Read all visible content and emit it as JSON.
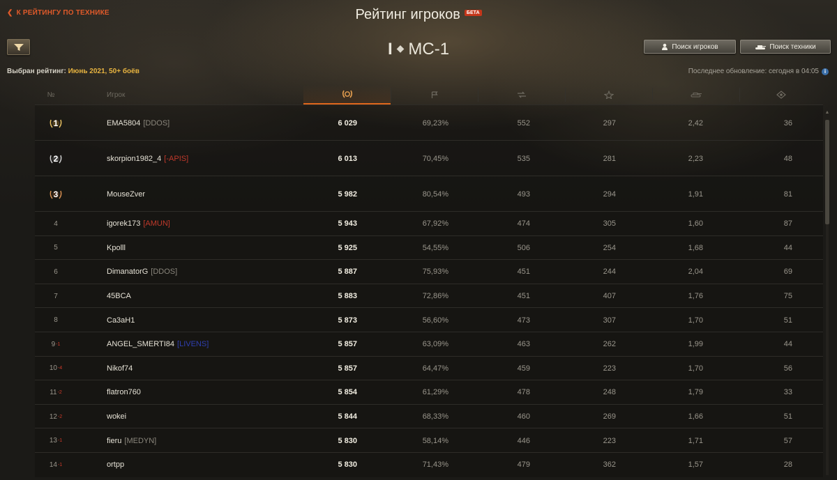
{
  "nav": {
    "back_label": "К РЕЙТИНГУ ПО ТЕХНИКЕ",
    "back_icon": "chevron-left-icon"
  },
  "header": {
    "title": "Рейтинг игроков",
    "beta_badge": "БЕТА",
    "vehicle_tier": "I",
    "vehicle_name": "МС-1"
  },
  "filter": {
    "icon": "filter-icon"
  },
  "buttons": {
    "find_players": "Поиск игроков",
    "find_vehicles": "Поиск техники"
  },
  "rating": {
    "label": "Выбран рейтинг:",
    "value": "Июнь 2021, 50+ боёв"
  },
  "update": {
    "label": "Последнее обновление: сегодня в 04:05"
  },
  "columns": {
    "rank": "№",
    "player": "Игрок",
    "score_icon": "laurel-icon",
    "winrate_icon": "flag-icon",
    "battles_icon": "battles-icon",
    "damage_icon": "damage-icon",
    "frags_icon": "frags-icon",
    "spot_icon": "spotting-icon"
  },
  "colors": {
    "accent": "#e0671c",
    "gold": "#e8b440",
    "clan_red": "#c0392b",
    "clan_blue": "#2f3fb0",
    "clan_gray": "#8a867c",
    "change_down": "#d03a2a"
  },
  "rows": [
    {
      "rank": "1",
      "change": "",
      "medal": "gold",
      "player": "EMA5804",
      "clan": "[DDOS]",
      "clan_color": "gray",
      "score": "6 029",
      "winrate": "69,23%",
      "battles": "552",
      "damage": "297",
      "frags": "2,42",
      "spot": "36"
    },
    {
      "rank": "2",
      "change": "",
      "medal": "silver",
      "player": "skorpion1982_4",
      "clan": "[-APIS]",
      "clan_color": "red",
      "score": "6 013",
      "winrate": "70,45%",
      "battles": "535",
      "damage": "281",
      "frags": "2,23",
      "spot": "48"
    },
    {
      "rank": "3",
      "change": "",
      "medal": "bronze",
      "player": "MouseZver",
      "clan": "",
      "clan_color": "gray",
      "score": "5 982",
      "winrate": "80,54%",
      "battles": "493",
      "damage": "294",
      "frags": "1,91",
      "spot": "81"
    },
    {
      "rank": "4",
      "change": "",
      "medal": "",
      "player": "igorek173",
      "clan": "[AMUN]",
      "clan_color": "red",
      "score": "5 943",
      "winrate": "67,92%",
      "battles": "474",
      "damage": "305",
      "frags": "1,60",
      "spot": "87"
    },
    {
      "rank": "5",
      "change": "",
      "medal": "",
      "player": "Kpolll",
      "clan": "",
      "clan_color": "gray",
      "score": "5 925",
      "winrate": "54,55%",
      "battles": "506",
      "damage": "254",
      "frags": "1,68",
      "spot": "44"
    },
    {
      "rank": "6",
      "change": "",
      "medal": "",
      "player": "DimanatorG",
      "clan": "[DDOS]",
      "clan_color": "gray",
      "score": "5 887",
      "winrate": "75,93%",
      "battles": "451",
      "damage": "244",
      "frags": "2,04",
      "spot": "69"
    },
    {
      "rank": "7",
      "change": "",
      "medal": "",
      "player": "45BCA",
      "clan": "",
      "clan_color": "gray",
      "score": "5 883",
      "winrate": "72,86%",
      "battles": "451",
      "damage": "407",
      "frags": "1,76",
      "spot": "75"
    },
    {
      "rank": "8",
      "change": "",
      "medal": "",
      "player": "Ca3aH1",
      "clan": "",
      "clan_color": "gray",
      "score": "5 873",
      "winrate": "56,60%",
      "battles": "473",
      "damage": "307",
      "frags": "1,70",
      "spot": "51"
    },
    {
      "rank": "9",
      "change": "-1",
      "medal": "",
      "player": "ANGEL_SMERTI84",
      "clan": "[LIVENS]",
      "clan_color": "blue",
      "score": "5 857",
      "winrate": "63,09%",
      "battles": "463",
      "damage": "262",
      "frags": "1,99",
      "spot": "44"
    },
    {
      "rank": "10",
      "change": "-4",
      "medal": "",
      "player": "Nikof74",
      "clan": "",
      "clan_color": "gray",
      "score": "5 857",
      "winrate": "64,47%",
      "battles": "459",
      "damage": "223",
      "frags": "1,70",
      "spot": "56"
    },
    {
      "rank": "11",
      "change": "-2",
      "medal": "",
      "player": "flatron760",
      "clan": "",
      "clan_color": "gray",
      "score": "5 854",
      "winrate": "61,29%",
      "battles": "478",
      "damage": "248",
      "frags": "1,79",
      "spot": "33"
    },
    {
      "rank": "12",
      "change": "-2",
      "medal": "",
      "player": "wokei",
      "clan": "",
      "clan_color": "gray",
      "score": "5 844",
      "winrate": "68,33%",
      "battles": "460",
      "damage": "269",
      "frags": "1,66",
      "spot": "51"
    },
    {
      "rank": "13",
      "change": "-1",
      "medal": "",
      "player": "fieru",
      "clan": "[MEDYN]",
      "clan_color": "gray",
      "score": "5 830",
      "winrate": "58,14%",
      "battles": "446",
      "damage": "223",
      "frags": "1,71",
      "spot": "57"
    },
    {
      "rank": "14",
      "change": "-1",
      "medal": "",
      "player": "ortpp",
      "clan": "",
      "clan_color": "gray",
      "score": "5 830",
      "winrate": "71,43%",
      "battles": "479",
      "damage": "362",
      "frags": "1,57",
      "spot": "28"
    }
  ]
}
